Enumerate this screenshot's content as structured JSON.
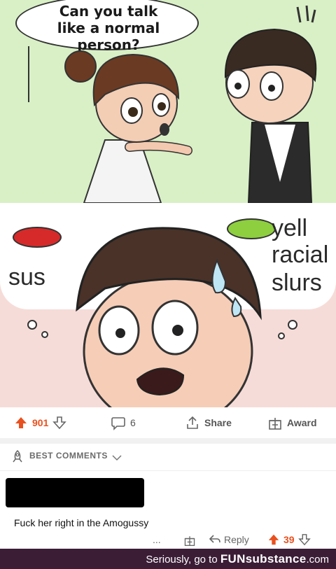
{
  "panel1": {
    "speech": [
      "Can you talk",
      "like a normal person?"
    ]
  },
  "panel2": {
    "left_label": "sus",
    "right_label": [
      "yell",
      "racial",
      "slurs"
    ]
  },
  "actions": {
    "upvotes": "901",
    "comments": "6",
    "share": "Share",
    "award": "Award",
    "vote_color": "#e8511f"
  },
  "sort": {
    "label": "BEST COMMENTS"
  },
  "comment": {
    "text": "Fuck her right in the Amogussy",
    "more": "...",
    "reply": "Reply",
    "votes": "39"
  },
  "footer": {
    "prefix": "Seriously, go to ",
    "brand": "FUNsubstance",
    "suffix": ".com"
  }
}
